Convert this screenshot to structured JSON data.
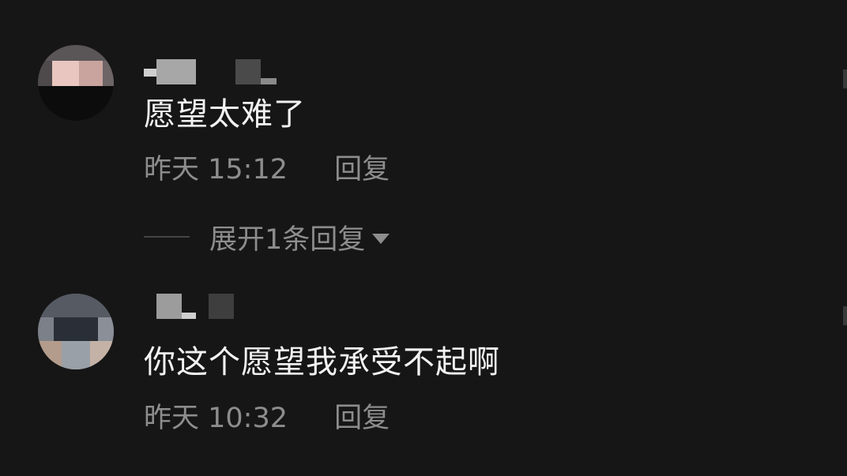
{
  "comments": [
    {
      "text": "愿望太难了",
      "time": "昨天 15:12",
      "reply_label": "回复",
      "expand_label": "展开1条回复"
    },
    {
      "text": "你这个愿望我承受不起啊",
      "time": "昨天 10:32",
      "reply_label": "回复"
    }
  ],
  "colors": {
    "background": "#161616",
    "primary_text": "#f2f2f2",
    "secondary_text": "#8d8d8d"
  }
}
